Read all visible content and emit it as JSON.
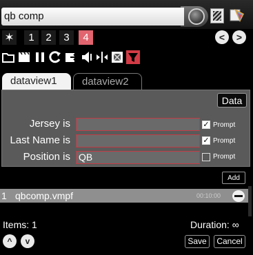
{
  "title": {
    "text": "qb comp"
  },
  "tabbar": {
    "items": [
      "1",
      "2",
      "3",
      "4"
    ],
    "active": "4"
  },
  "tabs": [
    {
      "label": "dataview1"
    },
    {
      "label": "dataview2"
    }
  ],
  "panel": {
    "data_button": "Data",
    "rows": [
      {
        "label": "Jersey is",
        "value": "",
        "prompt_checked": true
      },
      {
        "label": "Last Name is",
        "value": "",
        "prompt_checked": true
      },
      {
        "label": "Position is",
        "value": "QB",
        "prompt_checked": false
      }
    ],
    "prompt_label": "Prompt"
  },
  "add_button": "Add",
  "list": {
    "items": [
      {
        "index": "1",
        "name": "qbcomp.vmpf",
        "duration": "00:10:00"
      }
    ]
  },
  "footer": {
    "items_label": "Items: 1",
    "duration_label": "Duration: ∞",
    "save": "Save",
    "cancel": "Cancel"
  },
  "colors": {
    "accent": "#e1646f",
    "filter": "#d23b45",
    "field_border": "#c23a44"
  }
}
